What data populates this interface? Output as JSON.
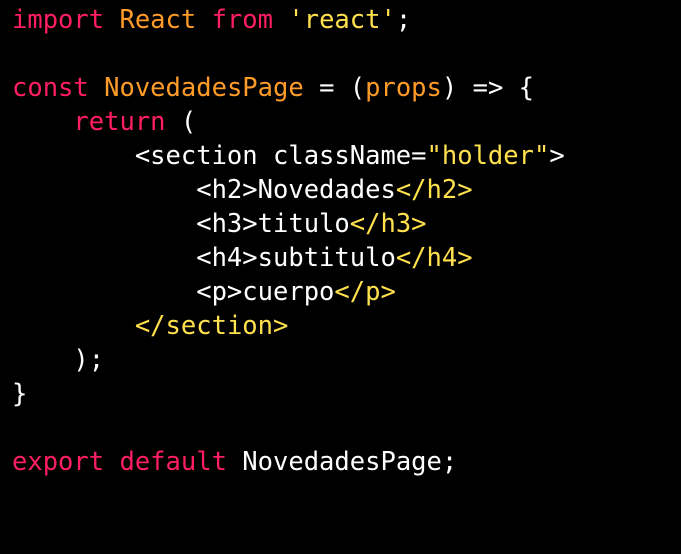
{
  "editor": {
    "language": "javascript",
    "colors": {
      "background": "#000000",
      "keyword": "#ff1e61",
      "identifier": "#ff9b28",
      "string": "#ffe14d",
      "text": "#ffffff"
    },
    "lines": [
      {
        "tokens": [
          {
            "t": "kw",
            "v": "import "
          },
          {
            "t": "id",
            "v": "React "
          },
          {
            "t": "kw",
            "v": "from "
          },
          {
            "t": "str",
            "v": "'react'"
          },
          {
            "t": "op",
            "v": ";"
          }
        ]
      },
      {
        "tokens": []
      },
      {
        "tokens": [
          {
            "t": "kw",
            "v": "const "
          },
          {
            "t": "id",
            "v": "NovedadesPage "
          },
          {
            "t": "op",
            "v": "= ("
          },
          {
            "t": "id",
            "v": "props"
          },
          {
            "t": "op",
            "v": ") => {"
          }
        ]
      },
      {
        "tokens": [
          {
            "t": "op",
            "v": "    "
          },
          {
            "t": "kw",
            "v": "return "
          },
          {
            "t": "op",
            "v": "("
          }
        ]
      },
      {
        "tokens": [
          {
            "t": "op",
            "v": "        <section className="
          },
          {
            "t": "str",
            "v": "\"holder\""
          },
          {
            "t": "op",
            "v": ">"
          }
        ]
      },
      {
        "tokens": [
          {
            "t": "op",
            "v": "            <h2>Novedades"
          },
          {
            "t": "close",
            "v": "</h2>"
          }
        ]
      },
      {
        "tokens": [
          {
            "t": "op",
            "v": "            <h3>titulo"
          },
          {
            "t": "close",
            "v": "</h3>"
          }
        ]
      },
      {
        "tokens": [
          {
            "t": "op",
            "v": "            <h4>subtitulo"
          },
          {
            "t": "close",
            "v": "</h4>"
          }
        ]
      },
      {
        "tokens": [
          {
            "t": "op",
            "v": "            <p>cuerpo"
          },
          {
            "t": "close",
            "v": "</p>"
          }
        ]
      },
      {
        "tokens": [
          {
            "t": "op",
            "v": "        "
          },
          {
            "t": "close",
            "v": "</section>"
          }
        ]
      },
      {
        "tokens": [
          {
            "t": "op",
            "v": "    );"
          }
        ]
      },
      {
        "tokens": [
          {
            "t": "op",
            "v": "}"
          }
        ]
      },
      {
        "tokens": []
      },
      {
        "tokens": [
          {
            "t": "kw",
            "v": "export default "
          },
          {
            "t": "fn",
            "v": "NovedadesPage;"
          }
        ]
      }
    ]
  }
}
